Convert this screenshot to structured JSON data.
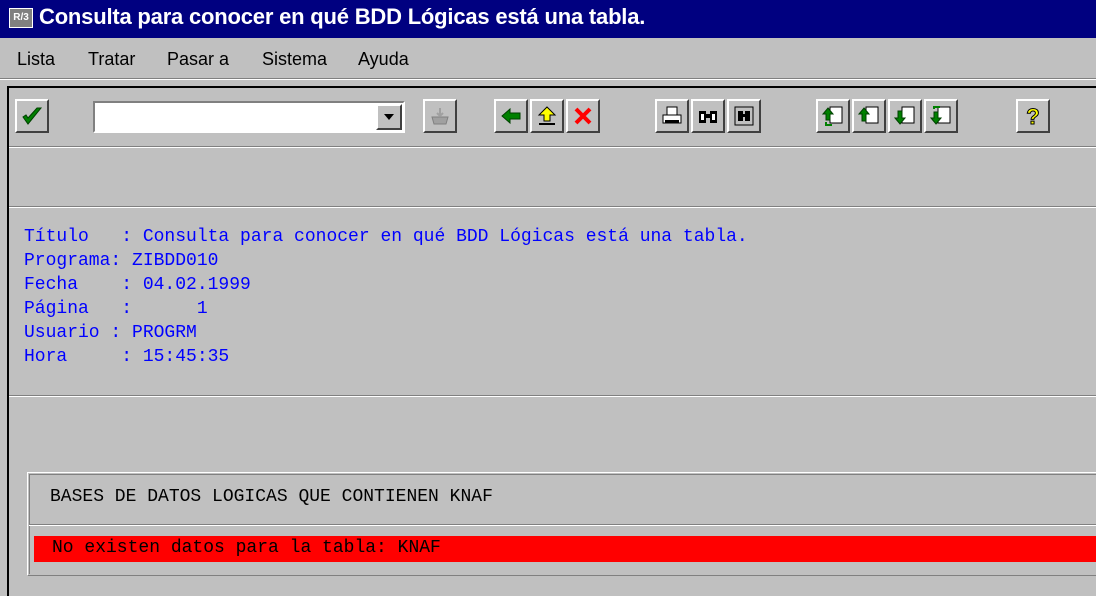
{
  "window": {
    "app_icon_text": "R/3",
    "title": "Consulta para conocer en qué BDD Lógicas está una tabla."
  },
  "menu": {
    "items": [
      {
        "label": "Lista"
      },
      {
        "label": "Tratar"
      },
      {
        "label": "Pasar a"
      },
      {
        "label": "Sistema"
      },
      {
        "label": "Ayuda"
      }
    ]
  },
  "toolbar": {
    "command_field": {
      "value": "",
      "placeholder": ""
    },
    "buttons": [
      {
        "icon": "check-icon"
      },
      {
        "icon": "save-icon"
      },
      {
        "icon": "back-arrow-icon"
      },
      {
        "icon": "exit-up-arrow-icon"
      },
      {
        "icon": "cancel-x-icon"
      },
      {
        "icon": "print-icon"
      },
      {
        "icon": "find-icon"
      },
      {
        "icon": "find-next-icon"
      },
      {
        "icon": "first-page-icon"
      },
      {
        "icon": "previous-page-icon"
      },
      {
        "icon": "next-page-icon"
      },
      {
        "icon": "last-page-icon"
      },
      {
        "icon": "help-icon"
      }
    ],
    "colors": {
      "green": "#008000",
      "red": "#ff0000",
      "yellow": "#ffff00"
    }
  },
  "header": {
    "lines": [
      "Título   : Consulta para conocer en qué BDD Lógicas está una tabla.",
      "Programa: ZIBDD010",
      "Fecha    : 04.02.1999",
      "Página   :      1",
      "Usuario : PROGRM",
      "Hora     : 15:45:35"
    ],
    "color": "#0000ff"
  },
  "list": {
    "heading": "BASES DE DATOS LOGICAS QUE CONTIENEN KNAF",
    "error_message": "No existen datos para la tabla: KNAF",
    "error_color": "#ff0000"
  }
}
